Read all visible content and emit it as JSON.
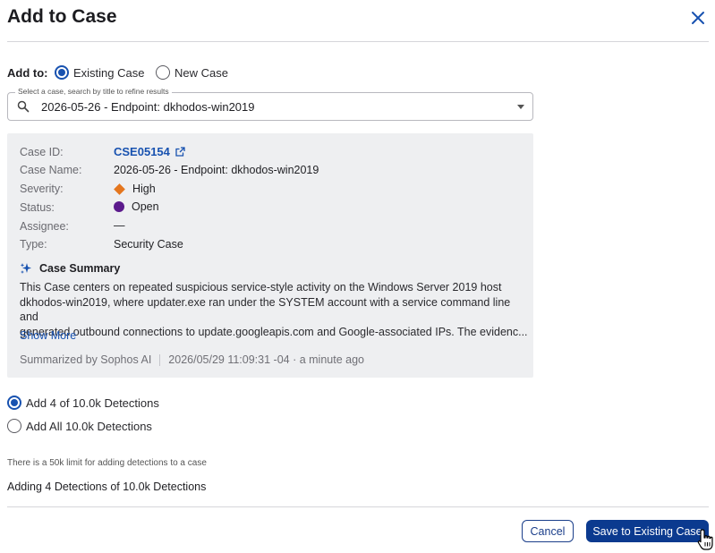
{
  "dialog": {
    "title": "Add to Case"
  },
  "add_to": {
    "label": "Add to:",
    "options": [
      {
        "label": "Existing Case",
        "selected": true
      },
      {
        "label": "New Case",
        "selected": false
      }
    ]
  },
  "case_select": {
    "legend": "Select a case, search by title to refine results",
    "value": "2026-05-26 - Endpoint: dkhodos-win2019"
  },
  "case_details": {
    "fields": {
      "case_id": {
        "label": "Case ID:",
        "value": "CSE05154"
      },
      "case_name": {
        "label": "Case Name:",
        "value": "2026-05-26 - Endpoint: dkhodos-win2019"
      },
      "severity": {
        "label": "Severity:",
        "value": "High",
        "color": "#e4761e"
      },
      "status": {
        "label": "Status:",
        "value": "Open",
        "color": "#5b1a8c"
      },
      "assignee": {
        "label": "Assignee:",
        "value": "—"
      },
      "type": {
        "label": "Type:",
        "value": "Security Case"
      }
    },
    "summary": {
      "title": "Case Summary",
      "text_lines": [
        "This Case centers on repeated suspicious service-style activity on the Windows Server 2019 host",
        "dkhodos-win2019, where updater.exe ran under the SYSTEM account with a service command line and",
        "generated outbound connections to update.googleapis.com and Google-associated IPs. The evidenc..."
      ],
      "show_more": "Show More",
      "summarized_by": "Summarized by Sophos AI",
      "timestamp": "2026/05/29 11:09:31 -04 · a minute ago"
    }
  },
  "detections": {
    "options": [
      {
        "label": "Add 4 of 10.0k Detections",
        "selected": true
      },
      {
        "label": "Add All 10.0k Detections",
        "selected": false
      }
    ],
    "limit_note": "There is a 50k limit for adding detections to a case",
    "adding_text": "Adding 4 Detections of 10.0k Detections"
  },
  "footer": {
    "cancel_label": "Cancel",
    "save_label": "Save to Existing Case"
  },
  "colors": {
    "accent": "#1852b0",
    "primary_button": "#0b3a8f"
  }
}
